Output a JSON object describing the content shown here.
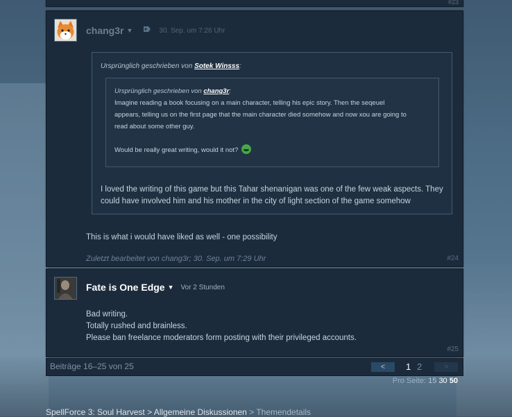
{
  "posts": [
    {
      "number": "#23"
    },
    {
      "author": "chang3r",
      "timestamp": "30. Sep. um 7:26 Uhr",
      "number": "#24",
      "outer_quote": {
        "prefix": "Ursprünglich geschrieben von",
        "author": "Sotek Winsss",
        "suffix": ":",
        "inner_quote": {
          "prefix": "Ursprünglich geschrieben von",
          "author": "chang3r",
          "suffix": ":",
          "lines": [
            "Imagine reading a book focusing on a main character, telling his epic story. Then the seqeuel",
            "appears, telling us on the first page that the main character died somehow and now xou are going to",
            "read about some other guy."
          ],
          "closing": "Would be really great writing, would it not?"
        },
        "reply_lines": [
          "I loved the writing of this game but this Tahar shenanigan was one of the few weak aspects. They",
          "could have involved him and his mother in the city of light section of the game somehow"
        ]
      },
      "body": "This is what i would have liked as well - one possibility",
      "edited_prefix": "Zuletzt bearbeitet von",
      "edited_author": "chang3r",
      "edited_suffix": "; 30. Sep. um 7:29 Uhr"
    },
    {
      "author": "Fate is One Edge",
      "timestamp": "Vor 2 Stunden",
      "number": "#25",
      "body_lines": [
        "Bad writing.",
        "Totally rushed and brainless.",
        "Please ban freelance moderators form posting with their privileged accounts."
      ]
    }
  ],
  "pagination": {
    "summary": "Beiträge 16–25 von 25",
    "prev": "<",
    "pages": [
      "1",
      "2"
    ],
    "current": "1",
    "next": ">"
  },
  "per_page": {
    "label": "Pro Seite:",
    "options": [
      "15",
      "30",
      "50"
    ],
    "selected": [
      "30",
      "50"
    ]
  },
  "breadcrumb": [
    "SpellForce 3: Soul Harvest",
    "Allgemeine Diskussionen",
    "Themendetails"
  ],
  "breadcrumb_sep": ">",
  "icons": {
    "author_menu": "chevron-down-icon",
    "award": "award-icon",
    "emoticon": "green-grin-emoticon"
  },
  "colors": {
    "panel": "#1c2b3c",
    "text": "#c6d4df",
    "link": "#ffffff"
  }
}
